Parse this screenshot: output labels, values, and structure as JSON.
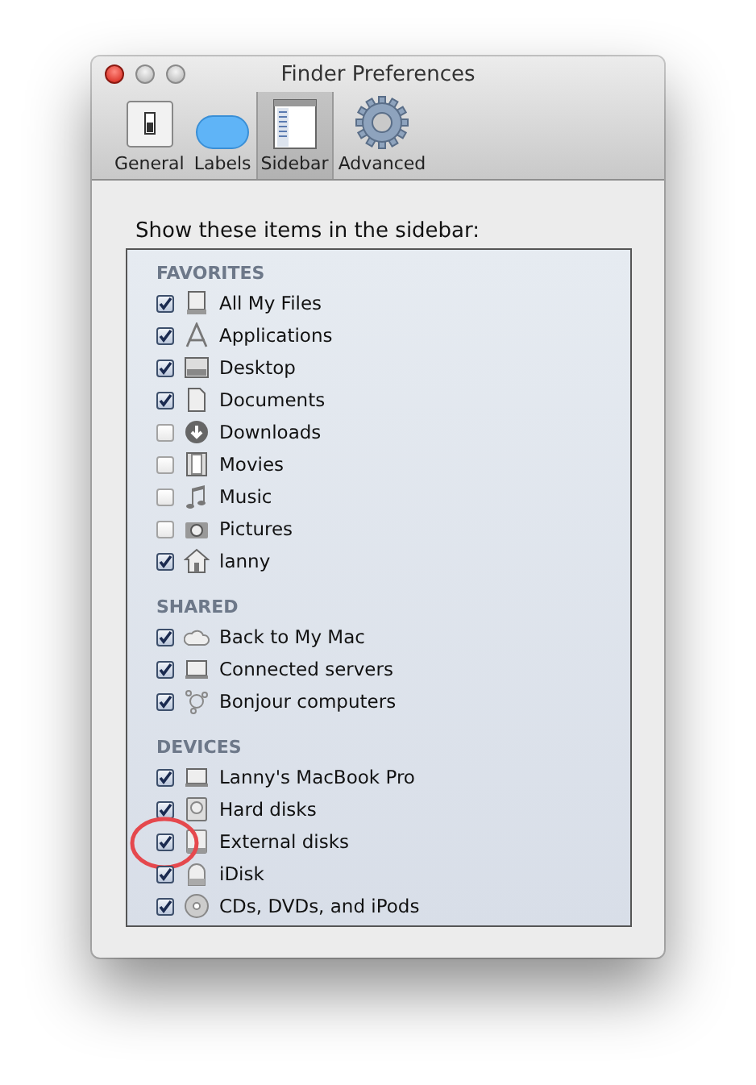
{
  "window": {
    "title": "Finder Preferences"
  },
  "toolbar": [
    {
      "label": "General",
      "selected": false
    },
    {
      "label": "Labels",
      "selected": false
    },
    {
      "label": "Sidebar",
      "selected": true
    },
    {
      "label": "Advanced",
      "selected": false
    }
  ],
  "heading": "Show these items in the sidebar:",
  "sections": [
    {
      "title": "FAVORITES",
      "items": [
        {
          "label": "All My Files",
          "checked": true,
          "circled": false
        },
        {
          "label": "Applications",
          "checked": true,
          "circled": false
        },
        {
          "label": "Desktop",
          "checked": true,
          "circled": false
        },
        {
          "label": "Documents",
          "checked": true,
          "circled": false
        },
        {
          "label": "Downloads",
          "checked": false,
          "circled": false
        },
        {
          "label": "Movies",
          "checked": false,
          "circled": false
        },
        {
          "label": "Music",
          "checked": false,
          "circled": false
        },
        {
          "label": "Pictures",
          "checked": false,
          "circled": false
        },
        {
          "label": "lanny",
          "checked": true,
          "circled": false
        }
      ]
    },
    {
      "title": "SHARED",
      "items": [
        {
          "label": "Back to My Mac",
          "checked": true,
          "circled": false
        },
        {
          "label": "Connected servers",
          "checked": true,
          "circled": false
        },
        {
          "label": "Bonjour computers",
          "checked": true,
          "circled": false
        }
      ]
    },
    {
      "title": "DEVICES",
      "items": [
        {
          "label": "Lanny's MacBook Pro",
          "checked": true,
          "circled": false
        },
        {
          "label": "Hard disks",
          "checked": true,
          "circled": false
        },
        {
          "label": "External disks",
          "checked": true,
          "circled": true
        },
        {
          "label": "iDisk",
          "checked": true,
          "circled": false
        },
        {
          "label": "CDs, DVDs, and iPods",
          "checked": true,
          "circled": false
        }
      ]
    }
  ]
}
